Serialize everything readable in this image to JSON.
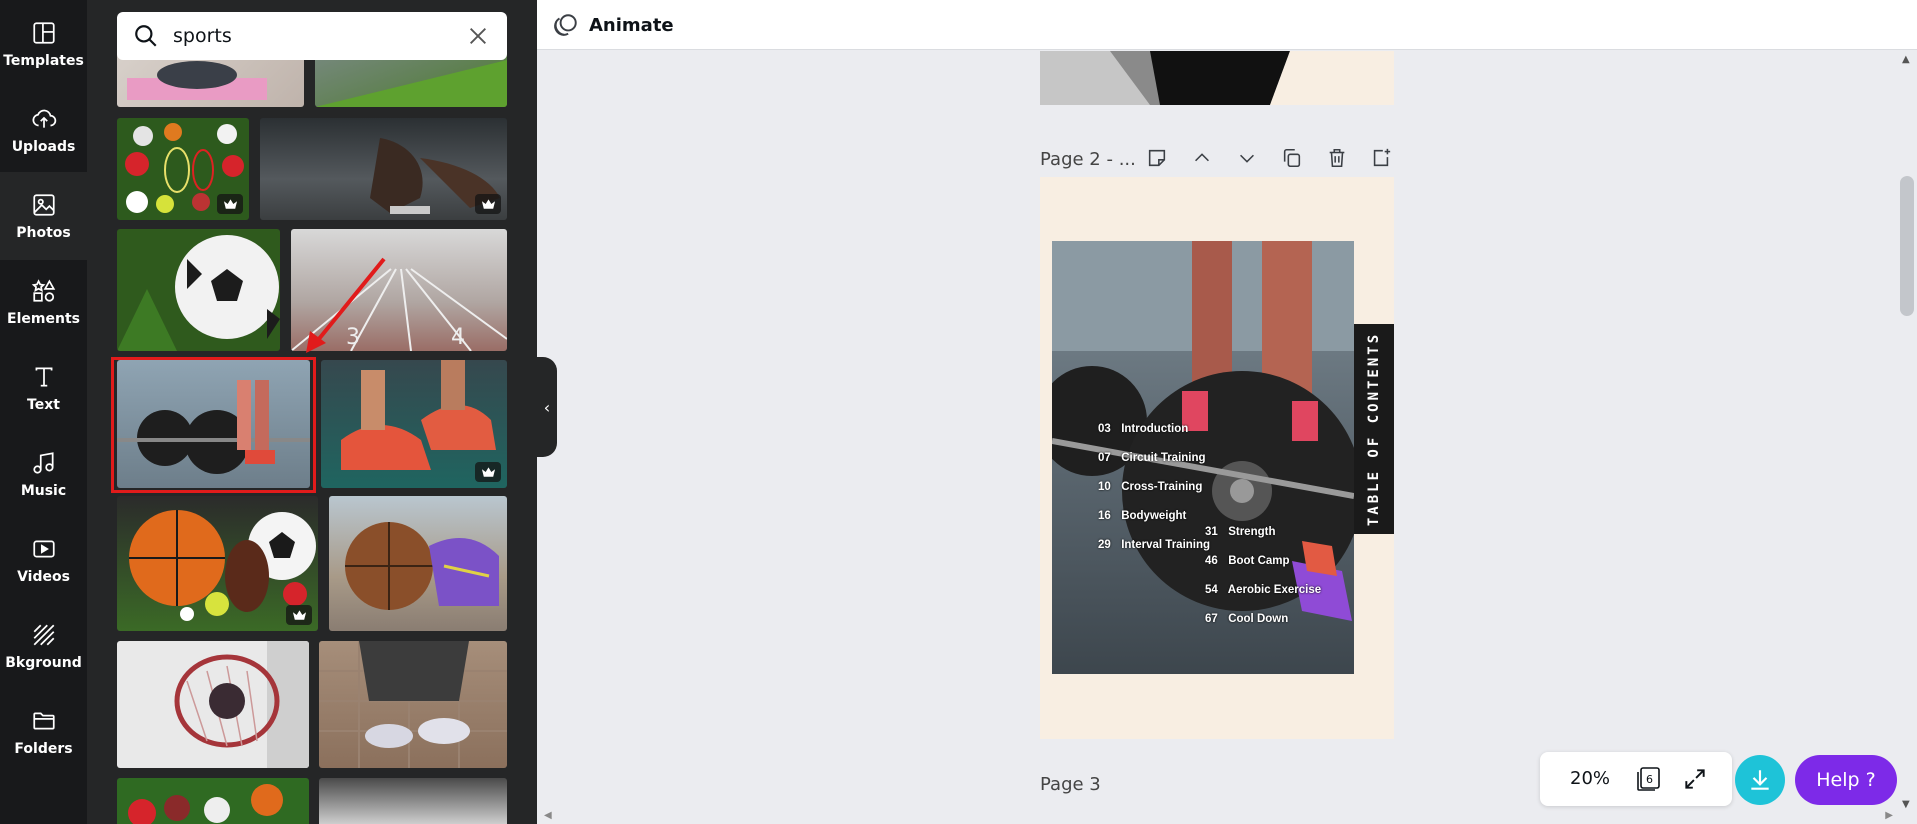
{
  "rail": {
    "items": [
      {
        "label": "Templates",
        "icon": "templates-icon"
      },
      {
        "label": "Uploads",
        "icon": "cloud-upload-icon"
      },
      {
        "label": "Photos",
        "icon": "photo-icon"
      },
      {
        "label": "Elements",
        "icon": "shapes-icon"
      },
      {
        "label": "Text",
        "icon": "text-icon"
      },
      {
        "label": "Music",
        "icon": "music-note-icon"
      },
      {
        "label": "Videos",
        "icon": "video-icon"
      },
      {
        "label": "Bkground",
        "icon": "background-pattern-icon"
      },
      {
        "label": "Folders",
        "icon": "folder-icon"
      }
    ],
    "active": "Photos"
  },
  "search": {
    "value": "sports"
  },
  "topbar": {
    "animate_label": "Animate"
  },
  "canvas": {
    "page2_label": "Page 2 - ...",
    "page3_label": "Page 3",
    "toc_title": "TABLE OF CONTENTS",
    "toc_entries": [
      {
        "num": "03",
        "title": "Introduction"
      },
      {
        "num": "07",
        "title": "Circuit Training"
      },
      {
        "num": "10",
        "title": "Cross-Training"
      },
      {
        "num": "16",
        "title": "Bodyweight"
      },
      {
        "num": "29",
        "title": "Interval Training"
      },
      {
        "num": "31",
        "title": "Strength"
      },
      {
        "num": "46",
        "title": "Boot Camp"
      },
      {
        "num": "54",
        "title": "Aerobic Exercise"
      },
      {
        "num": "67",
        "title": "Cool Down"
      }
    ]
  },
  "zoom": {
    "value": "20%",
    "pages_count": "6"
  },
  "help": {
    "label": "Help ?"
  },
  "colors": {
    "rail_bg": "#18191b",
    "panel_bg": "#252627",
    "highlight": "#e11b1b",
    "download": "#1ec3d8",
    "help": "#7d2ae8",
    "page_bg": "#f8eee2"
  }
}
